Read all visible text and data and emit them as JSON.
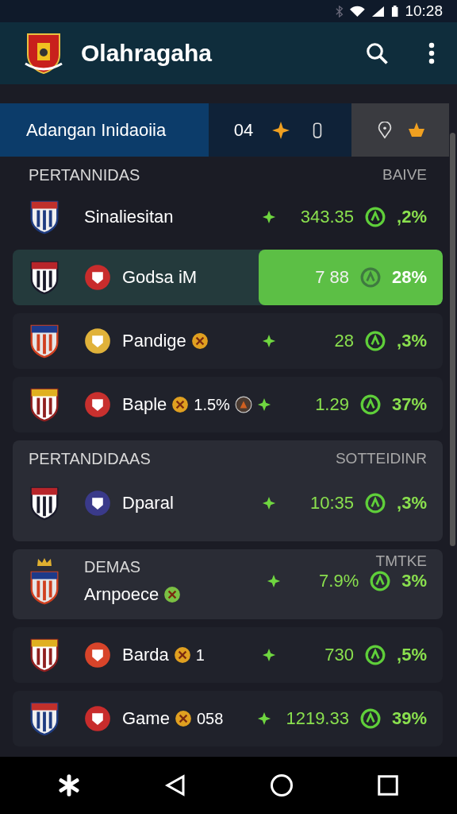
{
  "status_bar": {
    "time": "10:28"
  },
  "app_bar": {
    "title": "Olahragaha"
  },
  "tabs": [
    {
      "label": "Adangan Inidaoiia",
      "selected": true,
      "kind": "text"
    },
    {
      "label": "04",
      "selected": false,
      "kind": "count"
    },
    {
      "selected": false,
      "kind": "icons"
    }
  ],
  "sections": [
    {
      "title": "PERTANNIDAS",
      "right": "BAIVE",
      "kind": "plain",
      "rows": [
        {
          "kind": "crest",
          "name": "Sinaliesitan",
          "value": "343.35",
          "change": ",2%",
          "selected": false
        },
        {
          "kind": "club",
          "name": "Godsa iM",
          "value": "7 88",
          "change": "28%",
          "selected": true
        },
        {
          "kind": "club",
          "name": "Pandige",
          "badges": [
            {
              "kind": "coin"
            }
          ],
          "value": "28",
          "change": ",3%",
          "selected": false
        },
        {
          "kind": "club",
          "name": "Baple",
          "extra": "1.5%",
          "badges": [
            {
              "kind": "coin"
            },
            {
              "kind": "token"
            }
          ],
          "value": "1.29",
          "change": "37%",
          "selected": false
        }
      ]
    },
    {
      "title": "PERTANDIDAAS",
      "right": "SOTTEIDINR",
      "kind": "card",
      "rows": [
        {
          "kind": "club",
          "name": "Dparal",
          "value": "10:35",
          "change": ",3%",
          "selected": false
        }
      ]
    },
    {
      "title": "DEMAS",
      "right": "TMTKE",
      "kind": "card",
      "rows": [
        {
          "kind": "crown",
          "name": "Arnpoece",
          "badges": [
            {
              "kind": "leaf"
            }
          ],
          "value": "7.9%",
          "change": "3%",
          "selected": false
        }
      ]
    },
    {
      "kind": "plain",
      "rows": [
        {
          "kind": "club",
          "name": "Barda",
          "extra": "1",
          "badges": [
            {
              "kind": "coin"
            }
          ],
          "value": "730",
          "change": ",5%",
          "selected": false
        },
        {
          "kind": "club",
          "name": "Game",
          "extra": "058",
          "badges": [
            {
              "kind": "coin"
            }
          ],
          "value": "1219.33",
          "change": "39%",
          "selected": false
        }
      ]
    }
  ]
}
